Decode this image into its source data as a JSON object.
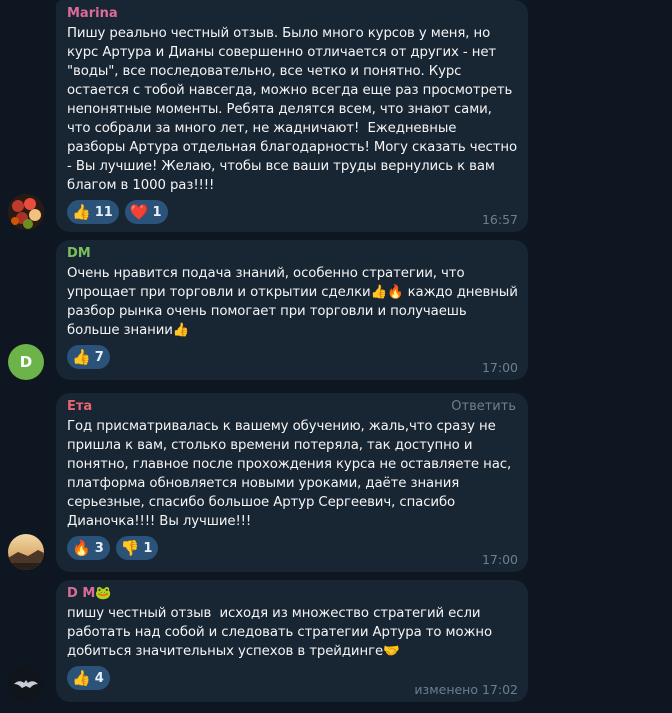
{
  "messages": [
    {
      "author": "Marina",
      "author_color": "#dd6b97",
      "text": "Пишу реально честный отзыв. Было много курсов у меня, но курс Артура и Дианы совершенно отличается от других - нет \"воды\", все последовательно, все четко и понятно. Курс остается с тобой навсегда, можно всегда еще раз просмотреть непонятные моменты. Ребята делятся всем, что знают сами, что собрали за много лет, не жадничают!  Ежедневные разборы Артура отдельная благодарность! Могу сказать честно - Вы лучшие! Желаю, чтобы все ваши труды вернулись к вам благом в 1000 раз!!!!",
      "reactions": [
        {
          "icon": "thumbs-up-icon",
          "emoji": "👍",
          "count": "11"
        },
        {
          "icon": "red-heart-icon",
          "emoji": "❤️",
          "count": "1"
        }
      ],
      "time": "16:57",
      "avatar": "flowers-photo"
    },
    {
      "author": "DM",
      "author_color": "#7ac15e",
      "text": "Очень нравится подача знаний, особенно стратегии, что упрощает при торговли и открытии сделки👍🔥 каждо дневный разбор рынка очень помогает при торговли и получаешь больше знании👍",
      "reactions": [
        {
          "icon": "thumbs-up-icon",
          "emoji": "👍",
          "count": "7"
        }
      ],
      "time": "17:00",
      "avatar_letter": "D",
      "avatar_color": "#6cb34a"
    },
    {
      "author": "Ета",
      "author_color": "#e76470",
      "reply_label": "Ответить",
      "text": "Год присматривалась к вашему обучению, жаль,что сразу не пришла к вам, столько времени потеряла, так доступно и понятно, главное после прохождения курса не оставляете нас, платформа обновляется новыми уроками, даёте знания серьезные, спасибо большое Артур Сергеевич, спасибо Дианочка!!!! Вы лучшие!!!",
      "reactions": [
        {
          "icon": "fire-icon",
          "emoji": "🔥",
          "count": "3"
        },
        {
          "icon": "thumbs-down-icon",
          "emoji": "👎",
          "count": "1"
        }
      ],
      "time": "17:00",
      "avatar": "landscape-photo"
    },
    {
      "author": "D M🐸",
      "author_color": "#dd6b97",
      "text": "пишу честный отзыв  исходя из множество стратегий если работать над собой и следовать стратегии Артура то можно добиться значительных успехов в трейдинге🤝",
      "reactions": [
        {
          "icon": "thumbs-up-icon",
          "emoji": "👍",
          "count": "4"
        }
      ],
      "time": "изменено 17:02",
      "avatar": "dark-logo"
    }
  ]
}
